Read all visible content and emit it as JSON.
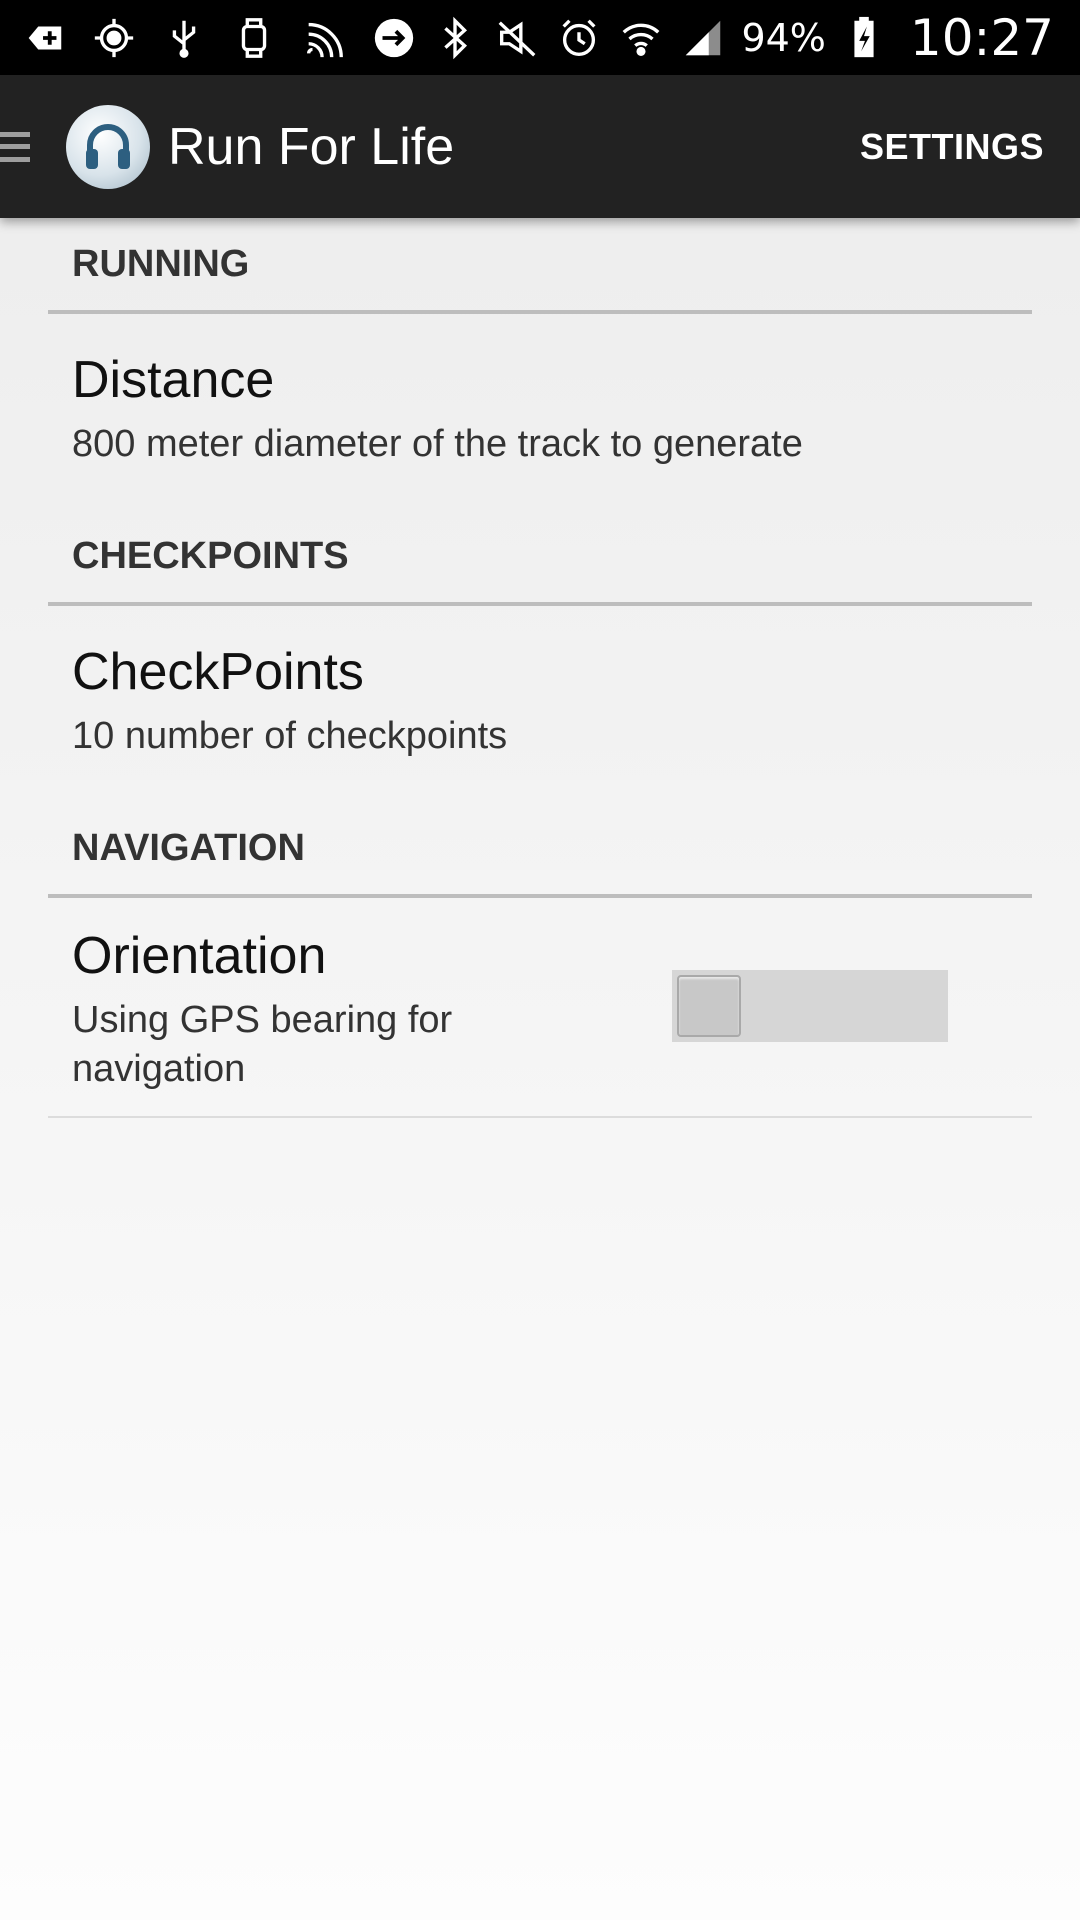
{
  "status_bar": {
    "icons_left": [
      "add-icon",
      "gps-icon",
      "usb-icon",
      "smartwatch-icon",
      "cast-icon",
      "arrow-circle-icon"
    ],
    "icons_right": [
      "bluetooth-icon",
      "mute-icon",
      "alarm-icon",
      "wifi-icon",
      "signal-icon",
      "battery-charging-icon"
    ],
    "battery": "94%",
    "time": "10:27"
  },
  "action_bar": {
    "title": "Run For Life",
    "settings_label": "SETTINGS"
  },
  "sections": {
    "running": {
      "header": "RUNNING",
      "pref_title": "Distance",
      "pref_summary": "800 meter diameter of the track to generate"
    },
    "checkpoints": {
      "header": "CHECKPOINTS",
      "pref_title": "CheckPoints",
      "pref_summary": "10 number of checkpoints"
    },
    "navigation": {
      "header": "NAVIGATION",
      "pref_title": "Orientation",
      "pref_summary": "Using GPS bearing for navigation",
      "toggle_on": false
    }
  },
  "colors": {
    "action_bar_bg": "#222222",
    "status_bar_bg": "#000000",
    "divider": "#bdbdbd"
  }
}
